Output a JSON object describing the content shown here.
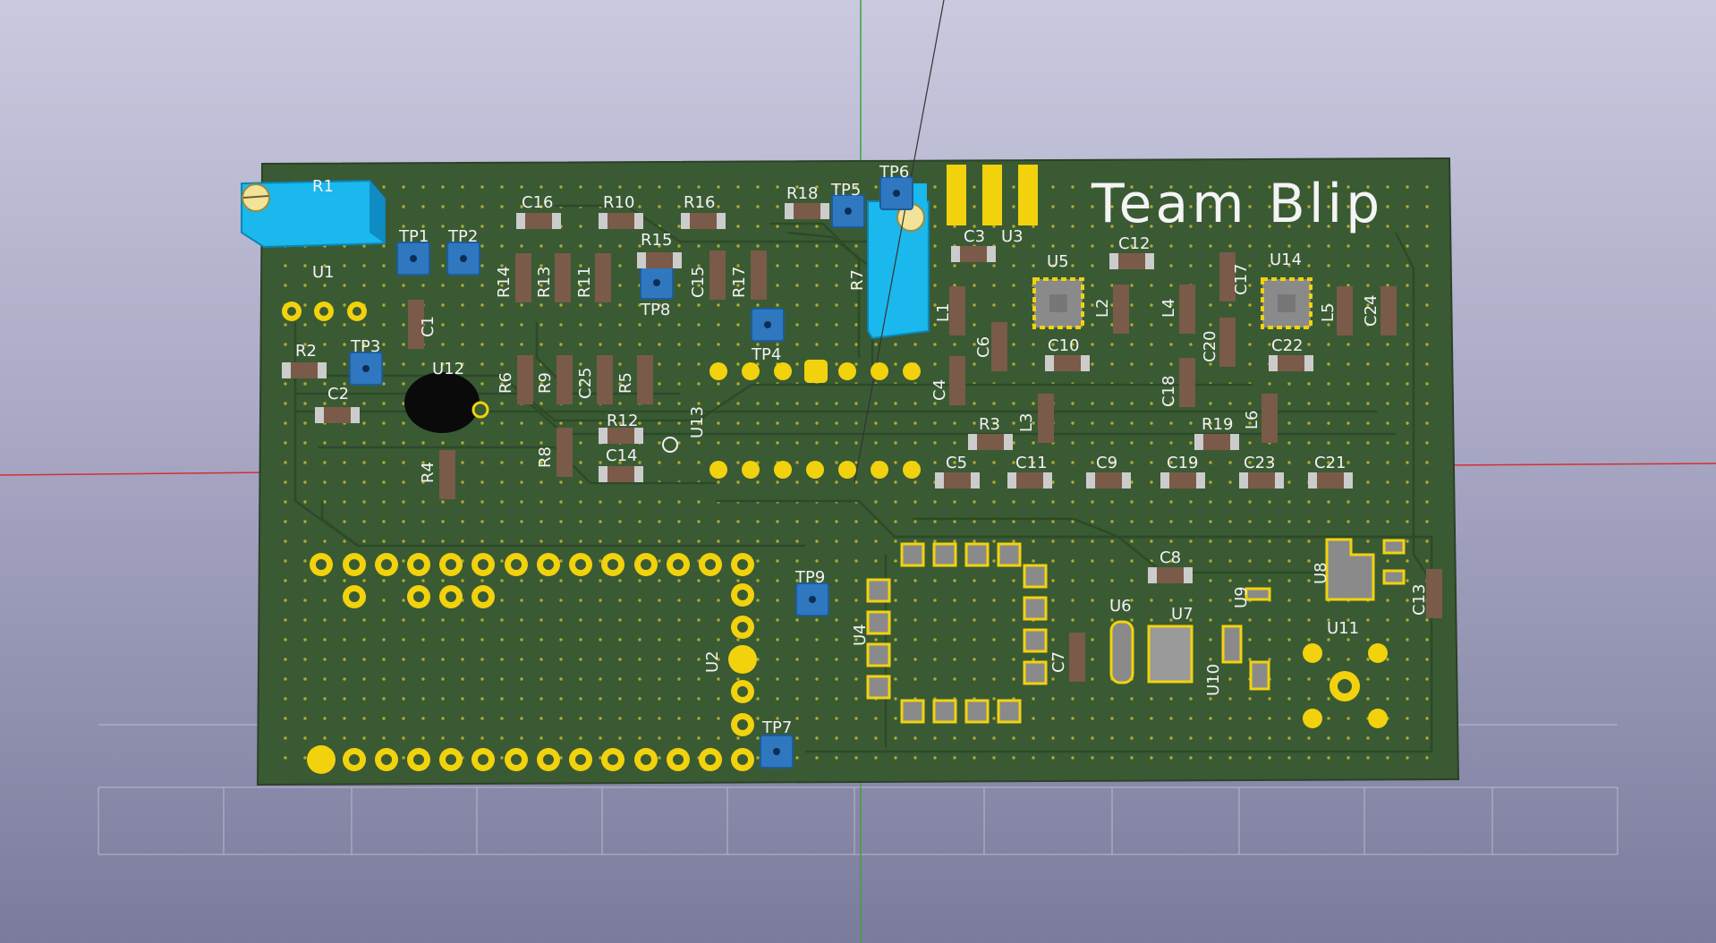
{
  "viewer": {
    "board_title": "Team Blip",
    "colors": {
      "background_top": "#c9c9df",
      "background_bottom": "#7b7b9c",
      "board": "#3a5a34",
      "copper": "#f2d20d",
      "silkscreen": "#f2f2f2",
      "test_point": "#2f78c0",
      "trimmer": "#1ab8ec",
      "x_axis": "#d23030",
      "y_axis": "#3fa33f"
    }
  },
  "labels": {
    "R1": "R1",
    "U1": "U1",
    "TP1": "TP1",
    "TP2": "TP2",
    "TP3": "TP3",
    "C1": "C1",
    "R2": "R2",
    "C2": "C2",
    "U12": "U12",
    "R4": "R4",
    "C16": "C16",
    "R10": "R10",
    "R16": "R16",
    "R18": "R18",
    "TP5": "TP5",
    "TP6": "TP6",
    "R14": "R14",
    "R13": "R13",
    "R11": "R11",
    "R15": "R15",
    "TP8": "TP8",
    "C15": "C15",
    "R17": "R17",
    "TP4": "TP4",
    "R7": "R7",
    "R6": "R6",
    "R9": "R9",
    "C25": "C25",
    "R5": "R5",
    "R12": "R12",
    "C14": "C14",
    "R8": "R8",
    "U13": "U13",
    "C3": "C3",
    "U3": "U3",
    "U5": "U5",
    "C12": "C12",
    "C17": "C17",
    "U14": "U14",
    "L1": "L1",
    "C6": "C6",
    "L2": "L2",
    "L4": "L4",
    "C20": "C20",
    "L5": "L5",
    "C24": "C24",
    "C10": "C10",
    "C22": "C22",
    "C4": "C4",
    "C18": "C18",
    "R3": "R3",
    "L3": "L3",
    "R19": "R19",
    "L6": "L6",
    "C5": "C5",
    "C11": "C11",
    "C9": "C9",
    "C19": "C19",
    "C23": "C23",
    "C21": "C21",
    "TP9": "TP9",
    "U4": "U4",
    "U2": "U2",
    "TP7": "TP7",
    "C8": "C8",
    "U9": "U9",
    "U8": "U8",
    "C13": "C13",
    "U6": "U6",
    "U7": "U7",
    "C7": "C7",
    "U10": "U10",
    "U11": "U11"
  }
}
